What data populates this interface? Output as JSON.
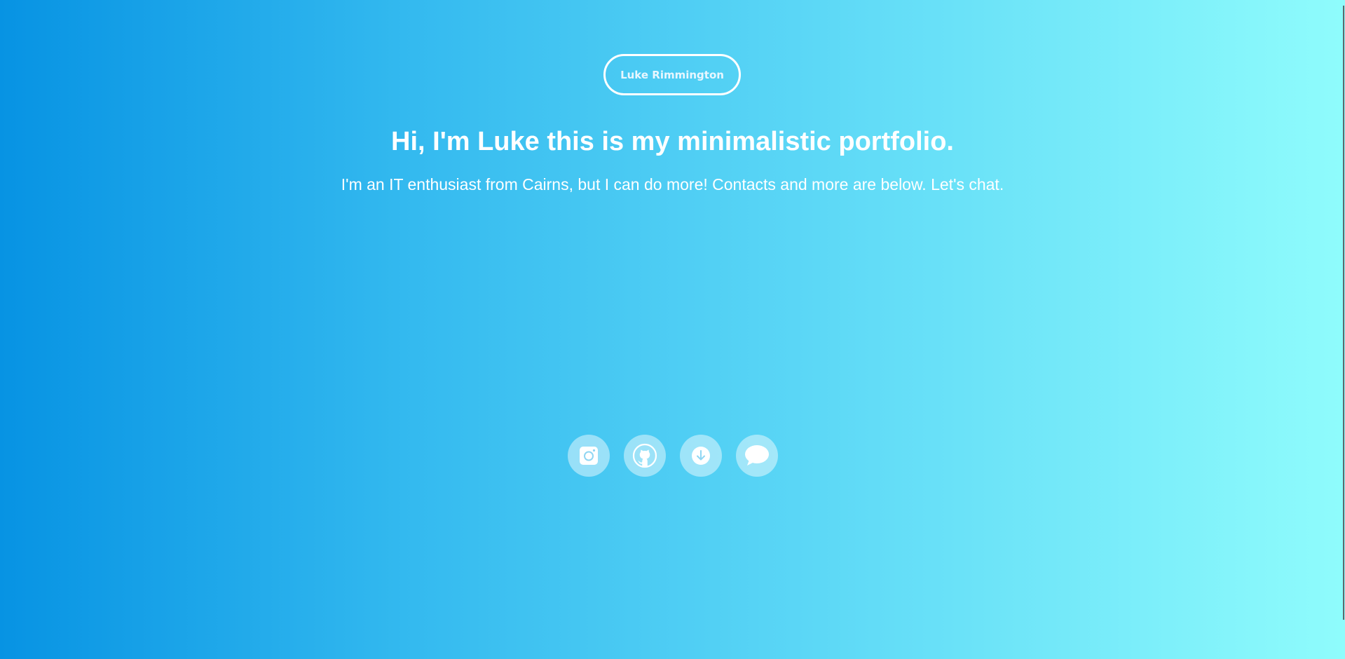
{
  "header": {
    "name_badge": "Luke Rimmington"
  },
  "hero": {
    "headline": "Hi, I'm Luke this is my minimalistic portfolio.",
    "tagline": "I'm an IT enthusiast from Cairns, but I can do more! Contacts and more are below. Let's chat."
  },
  "social_links": [
    {
      "icon": "instagram-icon"
    },
    {
      "icon": "github-icon"
    },
    {
      "icon": "download-icon"
    },
    {
      "icon": "chat-icon"
    }
  ],
  "colors": {
    "gradient_start": "#0793e3",
    "gradient_end": "#8ffcfc",
    "text": "#ffffff"
  }
}
